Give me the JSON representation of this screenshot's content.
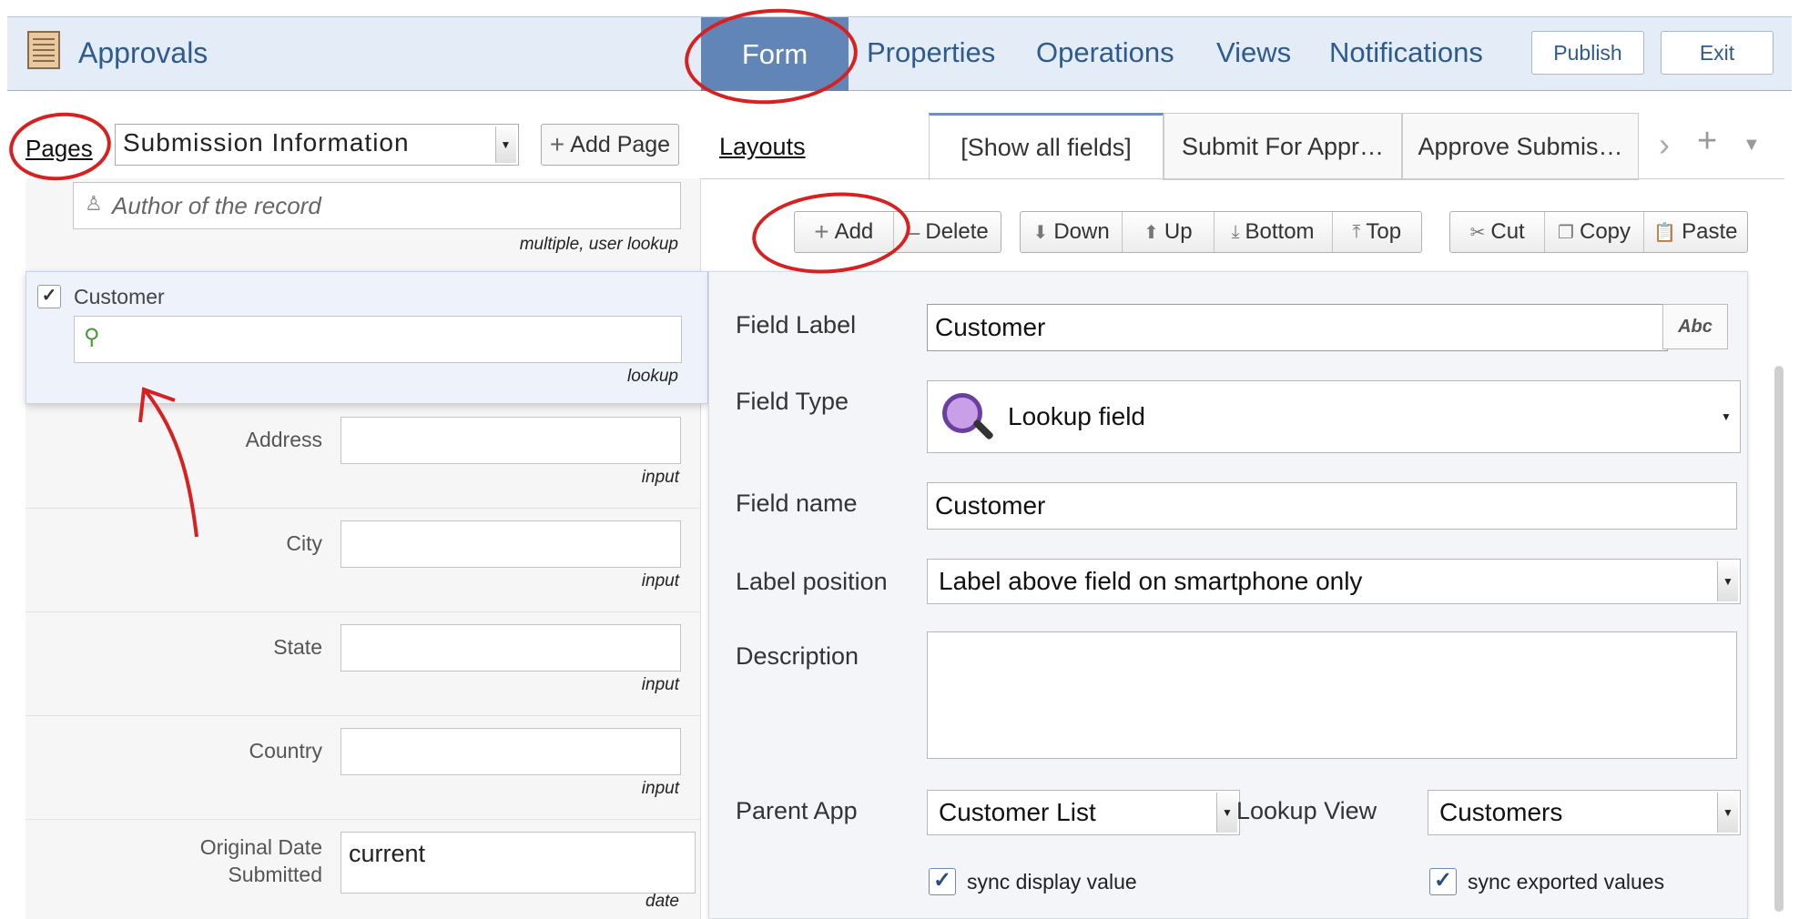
{
  "header": {
    "app_title": "Approvals",
    "tabs": [
      "Form",
      "Properties",
      "Operations",
      "Views",
      "Notifications"
    ],
    "active_tab": "Form",
    "publish_label": "Publish",
    "exit_label": "Exit"
  },
  "pages": {
    "link_label": "Pages",
    "selected_page": "Submission Information",
    "add_page_label": "Add Page"
  },
  "layouts": {
    "link_label": "Layouts",
    "tabs": [
      "[Show all fields]",
      "Submit For Appr…",
      "Approve Submis…"
    ]
  },
  "toolbar": {
    "add": "Add",
    "delete": "Delete",
    "down": "Down",
    "up": "Up",
    "bottom": "Bottom",
    "top": "Top",
    "cut": "Cut",
    "copy": "Copy",
    "paste": "Paste"
  },
  "form_fields": {
    "author": {
      "placeholder": "Author of the record",
      "hint": "multiple, user lookup"
    },
    "customer": {
      "label": "Customer",
      "hint": "lookup"
    },
    "address": {
      "label": "Address",
      "hint": "input"
    },
    "city": {
      "label": "City",
      "hint": "input"
    },
    "state": {
      "label": "State",
      "hint": "input"
    },
    "country": {
      "label": "Country",
      "hint": "input"
    },
    "original_date": {
      "label_line1": "Original Date",
      "label_line2": "Submitted",
      "value": "current",
      "hint": "date"
    }
  },
  "properties": {
    "field_label": {
      "label": "Field Label",
      "value": "Customer",
      "abc": "Abc"
    },
    "field_type": {
      "label": "Field Type",
      "value": "Lookup field"
    },
    "field_name": {
      "label": "Field name",
      "value": "Customer"
    },
    "label_position": {
      "label": "Label position",
      "value": "Label above field on smartphone only"
    },
    "description": {
      "label": "Description",
      "value": ""
    },
    "parent_app": {
      "label": "Parent App",
      "value": "Customer List"
    },
    "lookup_view": {
      "label": "Lookup View",
      "value": "Customers"
    },
    "sync_display": "sync display value",
    "sync_exported": "sync exported values"
  },
  "colors": {
    "accent": "#6285b8",
    "annotation": "#d82020"
  }
}
